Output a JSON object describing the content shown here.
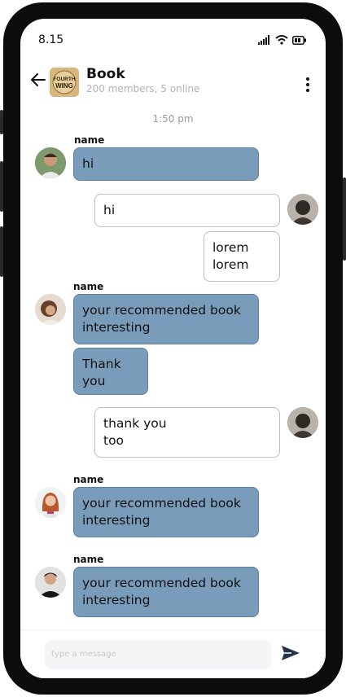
{
  "status": {
    "time": "8.15"
  },
  "header": {
    "title": "Book",
    "subtitle": "200 members, 5 online",
    "group_logo_text": "FOURTH WING"
  },
  "chat": {
    "timestamp": "1:50 pm",
    "messages": [
      {
        "sender_label": "name",
        "text": "hi"
      },
      {
        "text": "hi"
      },
      {
        "text": "lorem\nlorem"
      },
      {
        "sender_label": "name",
        "text": "your recommended book\ninteresting"
      },
      {
        "text": "Thank\nyou"
      },
      {
        "text": "thank you\ntoo"
      },
      {
        "sender_label": "name",
        "text": "your recommended book\ninteresting"
      },
      {
        "sender_label": "name",
        "text": "your recommended book\ninteresting"
      }
    ]
  },
  "composer": {
    "placeholder": "type a message"
  },
  "colors": {
    "incoming_bubble": "#7a9cbb",
    "outgoing_bubble": "#ffffff",
    "frame": "#0c0c0c"
  }
}
